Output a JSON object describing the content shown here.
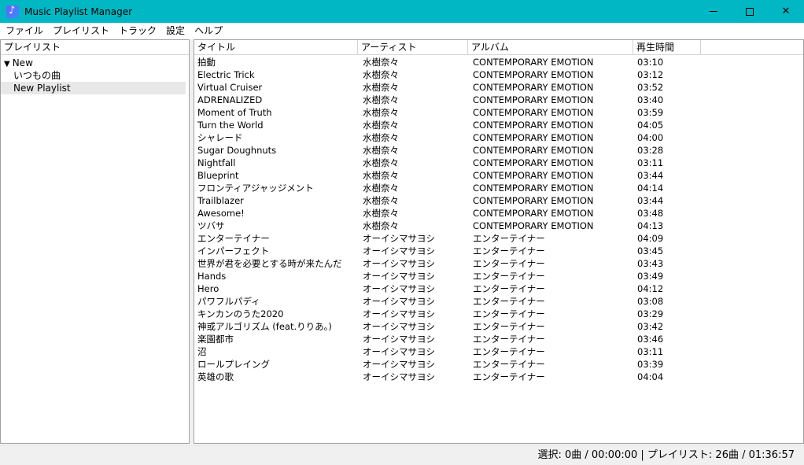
{
  "window": {
    "title": "Music Playlist Manager"
  },
  "menu": [
    "ファイル",
    "プレイリスト",
    "トラック",
    "設定",
    "ヘルプ"
  ],
  "playlist_pane": {
    "header": "プレイリスト",
    "root": {
      "label": "New",
      "expanded": true
    },
    "children": [
      "いつもの曲",
      "New Playlist"
    ],
    "selected_index": 1
  },
  "columns": [
    "タイトル",
    "アーティスト",
    "アルバム",
    "再生時間"
  ],
  "tracks": [
    [
      "拍動",
      "水樹奈々",
      "CONTEMPORARY EMOTION",
      "03:10"
    ],
    [
      "Electric Trick",
      "水樹奈々",
      "CONTEMPORARY EMOTION",
      "03:12"
    ],
    [
      "Virtual Cruiser",
      "水樹奈々",
      "CONTEMPORARY EMOTION",
      "03:52"
    ],
    [
      "ADRENALIZED",
      "水樹奈々",
      "CONTEMPORARY EMOTION",
      "03:40"
    ],
    [
      "Moment of Truth",
      "水樹奈々",
      "CONTEMPORARY EMOTION",
      "03:59"
    ],
    [
      "Turn the World",
      "水樹奈々",
      "CONTEMPORARY EMOTION",
      "04:05"
    ],
    [
      "シャレード",
      "水樹奈々",
      "CONTEMPORARY EMOTION",
      "04:00"
    ],
    [
      "Sugar Doughnuts",
      "水樹奈々",
      "CONTEMPORARY EMOTION",
      "03:28"
    ],
    [
      "Nightfall",
      "水樹奈々",
      "CONTEMPORARY EMOTION",
      "03:11"
    ],
    [
      "Blueprint",
      "水樹奈々",
      "CONTEMPORARY EMOTION",
      "03:44"
    ],
    [
      "フロンティアジャッジメント",
      "水樹奈々",
      "CONTEMPORARY EMOTION",
      "04:14"
    ],
    [
      "Trailblazer",
      "水樹奈々",
      "CONTEMPORARY EMOTION",
      "03:44"
    ],
    [
      "Awesome!",
      "水樹奈々",
      "CONTEMPORARY EMOTION",
      "03:48"
    ],
    [
      "ツバサ",
      "水樹奈々",
      "CONTEMPORARY EMOTION",
      "04:13"
    ],
    [
      "エンターテイナー",
      "オーイシマサヨシ",
      "エンターテイナー",
      "04:09"
    ],
    [
      "インパーフェクト",
      "オーイシマサヨシ",
      "エンターテイナー",
      "03:45"
    ],
    [
      "世界が君を必要とする時が来たんだ",
      "オーイシマサヨシ",
      "エンターテイナー",
      "03:43"
    ],
    [
      "Hands",
      "オーイシマサヨシ",
      "エンターテイナー",
      "03:49"
    ],
    [
      "Hero",
      "オーイシマサヨシ",
      "エンターテイナー",
      "04:12"
    ],
    [
      "パワフルパディ",
      "オーイシマサヨシ",
      "エンターテイナー",
      "03:08"
    ],
    [
      "キンカンのうた2020",
      "オーイシマサヨシ",
      "エンターテイナー",
      "03:29"
    ],
    [
      "神或アルゴリズム (feat.りりあ。)",
      "オーイシマサヨシ",
      "エンターテイナー",
      "03:42"
    ],
    [
      "楽園都市",
      "オーイシマサヨシ",
      "エンターテイナー",
      "03:46"
    ],
    [
      "沼",
      "オーイシマサヨシ",
      "エンターテイナー",
      "03:11"
    ],
    [
      "ロールプレイング",
      "オーイシマサヨシ",
      "エンターテイナー",
      "03:39"
    ],
    [
      "英雄の歌",
      "オーイシマサヨシ",
      "エンターテイナー",
      "04:04"
    ]
  ],
  "status": "選択: 0曲 / 00:00:00 | プレイリスト: 26曲 / 01:36:57",
  "colors": {
    "titlebar": "#00b7c3",
    "selection": "#e8e8e8"
  }
}
